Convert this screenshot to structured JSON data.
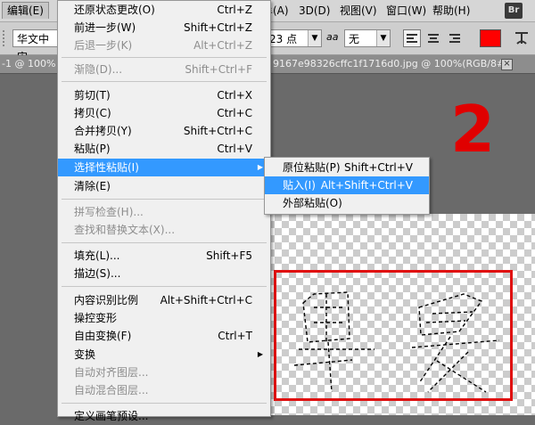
{
  "menubar": {
    "edit": "编辑(E)",
    "partial": "牟(A)",
    "threed": "3D(D)",
    "view": "视图(V)",
    "window": "窗口(W)",
    "help": "帮助(H)",
    "br": "Br"
  },
  "options": {
    "font_family": "华文中宋",
    "font_size": "23 点",
    "aa_icon": "aa",
    "aa_mode": "无",
    "text_color": "#ff0000"
  },
  "tabs": {
    "left": "-1 @ 100% (",
    "right": "9167e98326cffc1f1716d0.jpg @ 100%(RGB/8#)",
    "close": "×"
  },
  "canvas": {
    "annotation": "2"
  },
  "edit_menu": {
    "items": [
      {
        "label": "还原状态更改(O)",
        "shortcut": "Ctrl+Z"
      },
      {
        "label": "前进一步(W)",
        "shortcut": "Shift+Ctrl+Z"
      },
      {
        "label": "后退一步(K)",
        "shortcut": "Alt+Ctrl+Z"
      },
      {
        "label": "渐隐(D)...",
        "shortcut": "Shift+Ctrl+F"
      },
      {
        "label": "剪切(T)",
        "shortcut": "Ctrl+X"
      },
      {
        "label": "拷贝(C)",
        "shortcut": "Ctrl+C"
      },
      {
        "label": "合并拷贝(Y)",
        "shortcut": "Shift+Ctrl+C"
      },
      {
        "label": "粘贴(P)",
        "shortcut": "Ctrl+V"
      },
      {
        "label": "选择性粘贴(I)",
        "shortcut": ""
      },
      {
        "label": "清除(E)",
        "shortcut": ""
      },
      {
        "label": "拼写检查(H)...",
        "shortcut": ""
      },
      {
        "label": "查找和替换文本(X)...",
        "shortcut": ""
      },
      {
        "label": "填充(L)...",
        "shortcut": "Shift+F5"
      },
      {
        "label": "描边(S)...",
        "shortcut": ""
      },
      {
        "label": "内容识别比例",
        "shortcut": "Alt+Shift+Ctrl+C"
      },
      {
        "label": "操控变形",
        "shortcut": ""
      },
      {
        "label": "自由变换(F)",
        "shortcut": "Ctrl+T"
      },
      {
        "label": "变换",
        "shortcut": ""
      },
      {
        "label": "自动对齐图层...",
        "shortcut": ""
      },
      {
        "label": "自动混合图层...",
        "shortcut": ""
      },
      {
        "label": "定义画笔预设...",
        "shortcut": ""
      }
    ]
  },
  "paste_submenu": {
    "items": [
      {
        "label": "原位粘贴(P)",
        "shortcut": "Shift+Ctrl+V"
      },
      {
        "label": "贴入(I)",
        "shortcut": "Alt+Shift+Ctrl+V"
      },
      {
        "label": "外部粘贴(O)",
        "shortcut": ""
      }
    ]
  }
}
